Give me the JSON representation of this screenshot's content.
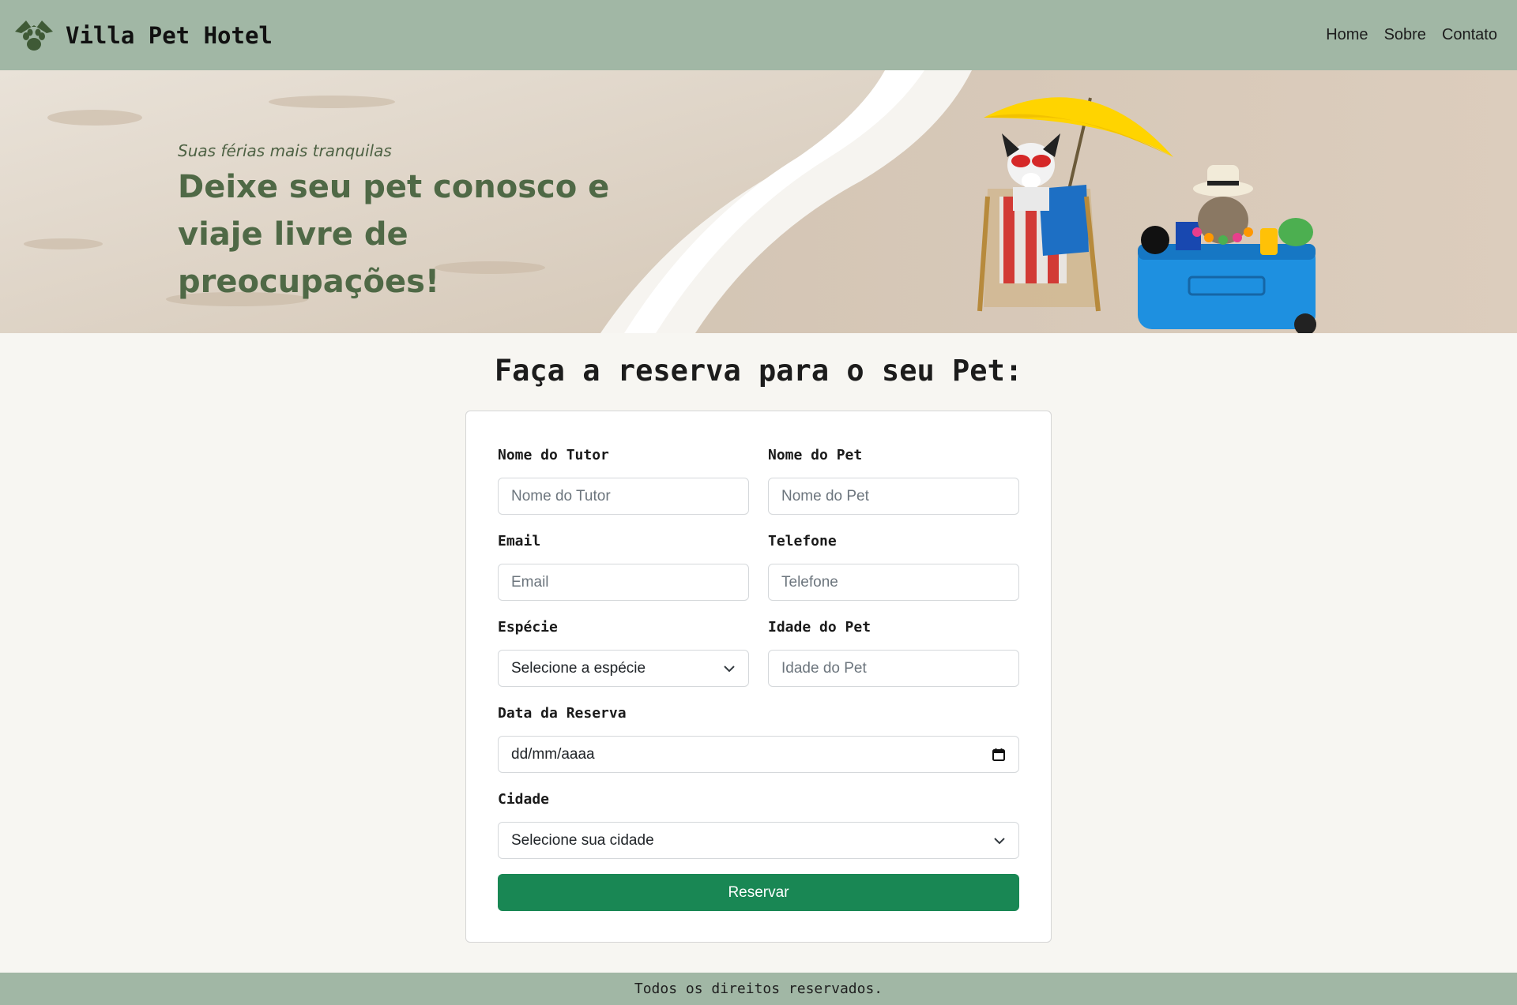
{
  "brand": {
    "name": "Villa Pet Hotel",
    "logo_icon": "paw-cat-logo-icon"
  },
  "nav": {
    "links": [
      "Home",
      "Sobre",
      "Contato"
    ]
  },
  "hero": {
    "subtitle": "Suas férias mais tranquilas",
    "title": "Deixe seu pet conosco e viaje livre de preocupações!"
  },
  "form": {
    "heading": "Faça a reserva para o seu Pet:",
    "tutor": {
      "label": "Nome do Tutor",
      "placeholder": "Nome do Tutor"
    },
    "pet": {
      "label": "Nome do Pet",
      "placeholder": "Nome do Pet"
    },
    "email": {
      "label": "Email",
      "placeholder": "Email"
    },
    "phone": {
      "label": "Telefone",
      "placeholder": "Telefone"
    },
    "species": {
      "label": "Espécie",
      "selected": "Selecione a espécie"
    },
    "age": {
      "label": "Idade do Pet",
      "placeholder": "Idade do Pet"
    },
    "date": {
      "label": "Data da Reserva",
      "value": "dd/mm/aaaa"
    },
    "city": {
      "label": "Cidade",
      "selected": "Selecione sua cidade"
    },
    "submit_label": "Reservar"
  },
  "footer": {
    "text": "Todos os direitos reservados."
  },
  "colors": {
    "navbar": "#a1b7a5",
    "hero_text": "#4f6946",
    "button": "#198754",
    "page_bg": "#f7f6f2"
  }
}
